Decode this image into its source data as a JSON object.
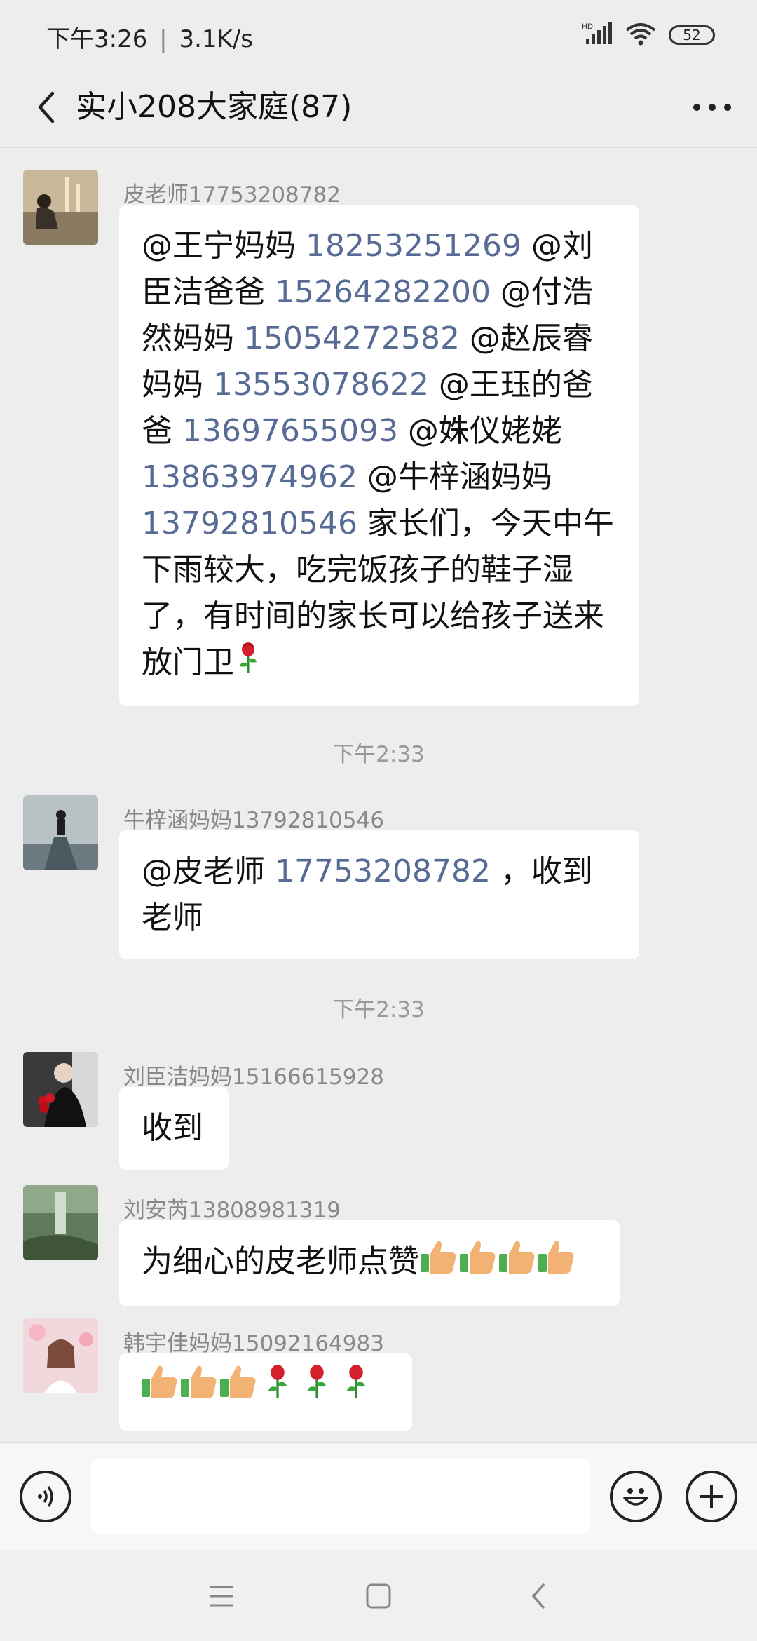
{
  "status": {
    "time": "下午3:26",
    "speed": "3.1K/s",
    "battery": "52",
    "network": "HD"
  },
  "chat": {
    "title": "实小208大家庭(87)"
  },
  "messages": [
    {
      "sender": "皮老师17753208782",
      "parts": [
        "@王宁妈妈 ",
        "18253251269",
        " @刘臣洁爸爸 ",
        "15264282200",
        " @付浩然妈妈 ",
        "15054272582",
        " @赵辰睿妈妈 ",
        "13553078622",
        " @王珏的爸爸 ",
        "13697655093",
        " @姝仪姥姥 ",
        "13863974962",
        " @牛梓涵妈妈 ",
        "13792810546",
        "  家长们，今天中午下雨较大，吃完饭孩子的鞋子湿了，有时间的家长可以给孩子送来放门卫"
      ]
    },
    {
      "timestamp": "下午2:33"
    },
    {
      "sender": "牛梓涵妈妈13792810546",
      "parts": [
        "@皮老师 ",
        "17753208782",
        " ，收到老师"
      ]
    },
    {
      "timestamp": "下午2:33"
    },
    {
      "sender": "刘臣洁妈妈15166615928",
      "text": "收到"
    },
    {
      "sender": "刘安芮13808981319",
      "text": "为细心的皮老师点赞"
    },
    {
      "sender": "韩宇佳妈妈15092164983",
      "text": ""
    }
  ],
  "icons": {
    "back": "back-arrow-icon",
    "more": "more-dots-icon",
    "voice": "voice-icon",
    "emoji": "emoji-icon",
    "plus": "plus-icon",
    "rose": "rose-emoji",
    "thumbs_up": "thumbs-up-emoji"
  },
  "colors": {
    "link": "#576b95",
    "background": "#ededed",
    "bubble": "#ffffff"
  }
}
